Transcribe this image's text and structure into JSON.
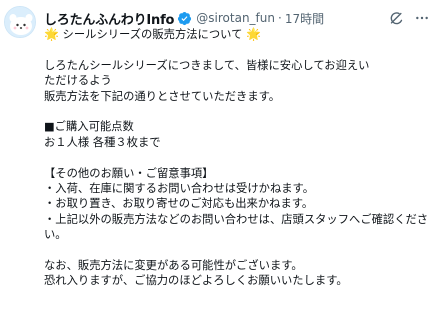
{
  "tweet": {
    "display_name": "しろたんふんわりInfo",
    "handle": "@sirotan_fun",
    "separator": "·",
    "time": "17時間",
    "title_star_left": "🌟",
    "title_text": "シールシリーズの販売方法について",
    "title_star_right": "🌟",
    "lines": [
      "",
      "しろたんシールシリーズにつきまして、皆様に安心してお迎えいただけるよう",
      "販売方法を下記の通りとさせていただきます。",
      "",
      "■ご購入可能点数",
      "お１人様 各種３枚まで",
      "",
      "【その他のお願い・ご留意事項】",
      "・入荷、在庫に関するお問い合わせは受けかねます。",
      "・お取り置き、お取り寄せのご対応も出来かねます。",
      "・上記以外の販売方法などのお問い合わせは、店頭スタッフへご確認ください。",
      "",
      "なお、販売方法に変更がある可能性がございます。",
      "恐れ入りますが、ご協力のほどよろしくお願いいたします。"
    ]
  },
  "icons": {
    "verified": "verified-badge-icon",
    "grok": "grok-icon",
    "more": "more-icon",
    "avatar": "sirotan-avatar"
  },
  "colors": {
    "text": "#0f1419",
    "secondary": "#536471",
    "verified": "#1d9bf0",
    "star": "#f5b400"
  }
}
